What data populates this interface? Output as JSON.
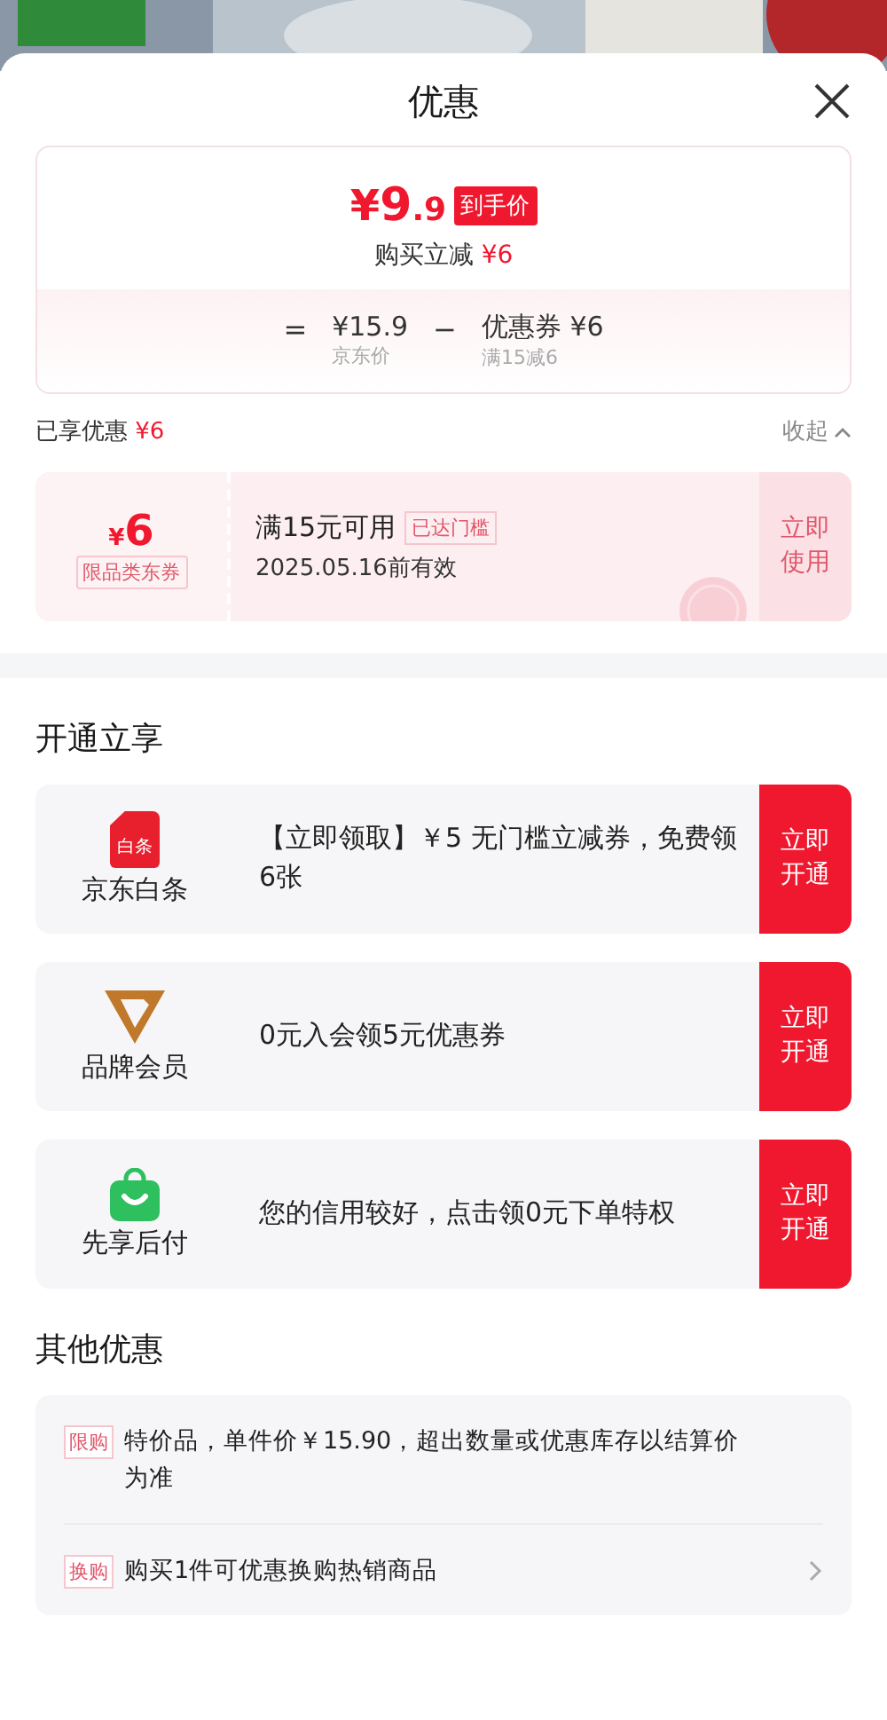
{
  "header": {
    "title": "优惠"
  },
  "price_card": {
    "price_symbol": "¥",
    "price_int": "9",
    "price_dec": ".9",
    "price_tag": "到手价",
    "reduce_label": "购买立减",
    "reduce_amount": "¥6",
    "formula": [
      {
        "kind": "operator",
        "text": "="
      },
      {
        "kind": "term",
        "value": "¥15.9",
        "caption": "京东价"
      },
      {
        "kind": "operator",
        "text": "−"
      },
      {
        "kind": "term",
        "value": "优惠券 ¥6",
        "caption": "满15减6"
      }
    ]
  },
  "enjoyed": {
    "label": "已享优惠",
    "amount": "¥6",
    "toggle": "收起",
    "expanded": true
  },
  "coupons": [
    {
      "symbol": "¥",
      "amount": "6",
      "type": "限品类东券",
      "condition": "满15元可用",
      "status": "已达门槛",
      "validity": "2025.05.16前有效",
      "action": "立即使用"
    }
  ],
  "open_section": {
    "title": "开通立享",
    "items": [
      {
        "kind": "baitiao",
        "name": "京东白条",
        "icon_text": "白条",
        "description": "【立即领取】￥5 无门槛立减券，免费领6张",
        "action": "立即开通"
      },
      {
        "kind": "member",
        "name": "品牌会员",
        "description": "0元入会领5元优惠券",
        "action": "立即开通"
      },
      {
        "kind": "paylater",
        "name": "先享后付",
        "description": "您的信用较好，点击领0元下单特权",
        "action": "立即开通"
      }
    ]
  },
  "other_section": {
    "title": "其他优惠",
    "items": [
      {
        "tag": "限购",
        "text": "特价品，单件价￥15.90，超出数量或优惠库存以结算价为准",
        "has_arrow": false
      },
      {
        "tag": "换购",
        "text": "购买1件可优惠换购热销商品",
        "has_arrow": true
      }
    ]
  }
}
